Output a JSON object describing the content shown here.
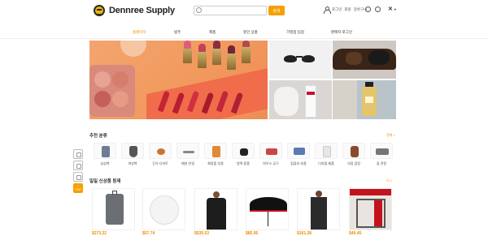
{
  "header": {
    "brand": "Dennree Supply",
    "search_button": "검색",
    "search_placeholder": "",
    "links": [
      "로그인",
      "회원",
      "장바구니",
      "설정"
    ],
    "lang": "한"
  },
  "nav": {
    "items": [
      {
        "label": "홈페이지",
        "active": true
      },
      {
        "label": "범주",
        "active": false
      },
      {
        "label": "제품",
        "active": false
      },
      {
        "label": "할인 상품",
        "active": false
      },
      {
        "label": "가맹점 입점",
        "active": false
      },
      {
        "label": "판매자 로그인",
        "active": false
      }
    ]
  },
  "categories": {
    "title": "추천 분류",
    "more": "전체 >",
    "items": [
      {
        "label": "남성복",
        "icon": "clothing-icon"
      },
      {
        "label": "여성복",
        "icon": "dress-icon"
      },
      {
        "label": "간식 디저트",
        "icon": "snack-icon"
      },
      {
        "label": "패션 안경",
        "icon": "glasses-icon"
      },
      {
        "label": "화장품 부품",
        "icon": "cosmetics-icon"
      },
      {
        "label": "방역 용품",
        "icon": "mask-icon"
      },
      {
        "label": "마우스 공구",
        "icon": "tools-icon"
      },
      {
        "label": "컴퓨터 부품",
        "icon": "laptop-icon"
      },
      {
        "label": "디지털 제품",
        "icon": "earbuds-icon"
      },
      {
        "label": "의류 검정",
        "icon": "handbag-icon"
      },
      {
        "label": "집 전정",
        "icon": "appliance-icon"
      }
    ]
  },
  "products": {
    "title": "일일 신상품 등재",
    "more": "더 >",
    "items": [
      {
        "price": "$273.22",
        "icon": "luggage-icon"
      },
      {
        "price": "$57.74",
        "icon": "golf-ball-icon"
      },
      {
        "price": "$535.53",
        "icon": "jacket-icon"
      },
      {
        "price": "$85.95",
        "icon": "umbrella-icon"
      },
      {
        "price": "$161.28",
        "icon": "overalls-icon"
      },
      {
        "price": "$49.45",
        "icon": "sport-equipment-icon"
      }
    ]
  },
  "sidebar": {
    "top_label": "TOP"
  }
}
